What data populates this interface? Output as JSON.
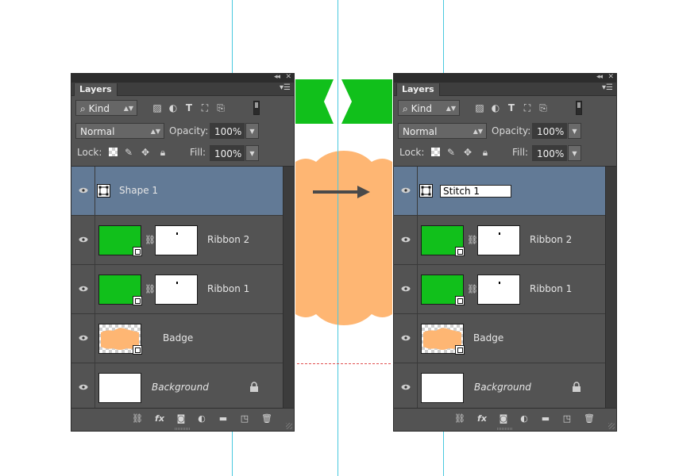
{
  "colors": {
    "ribbon": "#11c01b",
    "badge": "#feb673",
    "guide": "#49c9de",
    "selection": "#627a96"
  },
  "panels": [
    {
      "tab": "Layers",
      "filter_kind": "Kind",
      "blend_mode": "Normal",
      "opacity_label": "Opacity:",
      "opacity_value": "100%",
      "lock_label": "Lock:",
      "fill_label": "Fill:",
      "fill_value": "100%",
      "layers": [
        {
          "name": "Shape 1",
          "selected": true,
          "renaming": false
        },
        {
          "name": "Ribbon 2"
        },
        {
          "name": "Ribbon 1"
        },
        {
          "name": "Badge"
        },
        {
          "name": "Background"
        }
      ]
    },
    {
      "tab": "Layers",
      "filter_kind": "Kind",
      "blend_mode": "Normal",
      "opacity_label": "Opacity:",
      "opacity_value": "100%",
      "lock_label": "Lock:",
      "fill_label": "Fill:",
      "fill_value": "100%",
      "layers": [
        {
          "name": "Stitch 1",
          "selected": true,
          "renaming": true
        },
        {
          "name": "Ribbon 2"
        },
        {
          "name": "Ribbon 1"
        },
        {
          "name": "Badge"
        },
        {
          "name": "Background"
        }
      ]
    }
  ],
  "icons": {
    "filter": "search-icon",
    "pixel": "image-filter-icon",
    "adjust": "adjustment-filter-icon",
    "type": "type-filter-icon",
    "shape": "shape-filter-icon",
    "smart": "smart-object-filter-icon",
    "footer": [
      "link-layers-icon",
      "fx-icon",
      "mask-icon",
      "adjustment-icon",
      "group-icon",
      "new-layer-icon",
      "trash-icon"
    ]
  },
  "glyphs": {
    "fx": "fx",
    "type": "T",
    "menu": "▾☰",
    "collapse": "◂◂",
    "close": "✕",
    "spin": "▲▼",
    "down": "▼"
  }
}
